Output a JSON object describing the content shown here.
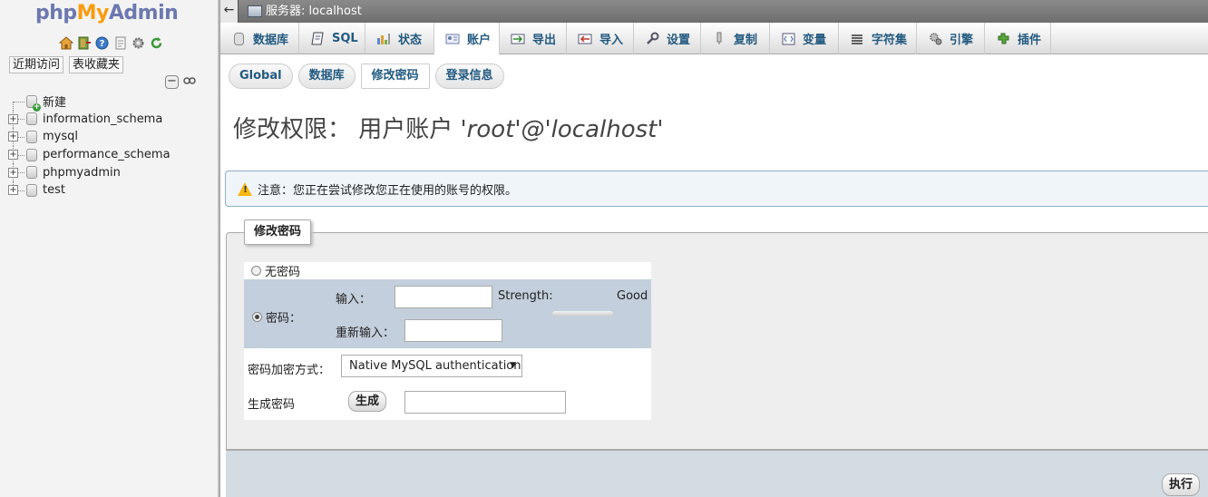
{
  "nav": {
    "logo": {
      "php": "php",
      "my": "My",
      "admin": "Admin"
    },
    "icons": [
      "home-icon",
      "exit-icon",
      "help-icon",
      "docs-icon",
      "settings-icon",
      "reload-icon"
    ],
    "tabs": [
      "近期访问",
      "表收藏夹"
    ],
    "tree": [
      {
        "name": "新建",
        "type": "new"
      },
      {
        "name": "information_schema",
        "type": "db"
      },
      {
        "name": "mysql",
        "type": "db"
      },
      {
        "name": "performance_schema",
        "type": "db"
      },
      {
        "name": "phpmyadmin",
        "type": "db"
      },
      {
        "name": "test",
        "type": "db"
      }
    ]
  },
  "topbar": {
    "back": "←",
    "server_label": "服务器: localhost"
  },
  "menu": [
    {
      "label": "数据库",
      "icon": "database-icon"
    },
    {
      "label": "SQL",
      "icon": "sql-icon"
    },
    {
      "label": "状态",
      "icon": "status-icon"
    },
    {
      "label": "账户",
      "icon": "accounts-icon",
      "active": true
    },
    {
      "label": "导出",
      "icon": "export-icon"
    },
    {
      "label": "导入",
      "icon": "import-icon"
    },
    {
      "label": "设置",
      "icon": "settings-icon"
    },
    {
      "label": "复制",
      "icon": "replication-icon"
    },
    {
      "label": "变量",
      "icon": "variables-icon"
    },
    {
      "label": "字符集",
      "icon": "charset-icon"
    },
    {
      "label": "引擎",
      "icon": "engine-icon"
    },
    {
      "label": "插件",
      "icon": "plugin-icon"
    }
  ],
  "subtabs": [
    "Global",
    "数据库",
    "修改密码",
    "登录信息"
  ],
  "page_title": {
    "prefix": "修改权限： 用户账户 ",
    "user": "'root'@'localhost'"
  },
  "notice": "注意：您正在尝试修改您正在使用的账号的权限。",
  "form": {
    "legend": "修改密码",
    "no_password": "无密码",
    "password": "密码：",
    "enter": "输入：",
    "reenter": "重新输入：",
    "strength_label": "Strength:",
    "strength_value": "Good",
    "hashing_label": "密码加密方式：",
    "hashing_value": "Native MySQL authentication",
    "generate_label": "生成密码",
    "generate_button": "生成"
  },
  "footer": {
    "execute": "执行"
  }
}
